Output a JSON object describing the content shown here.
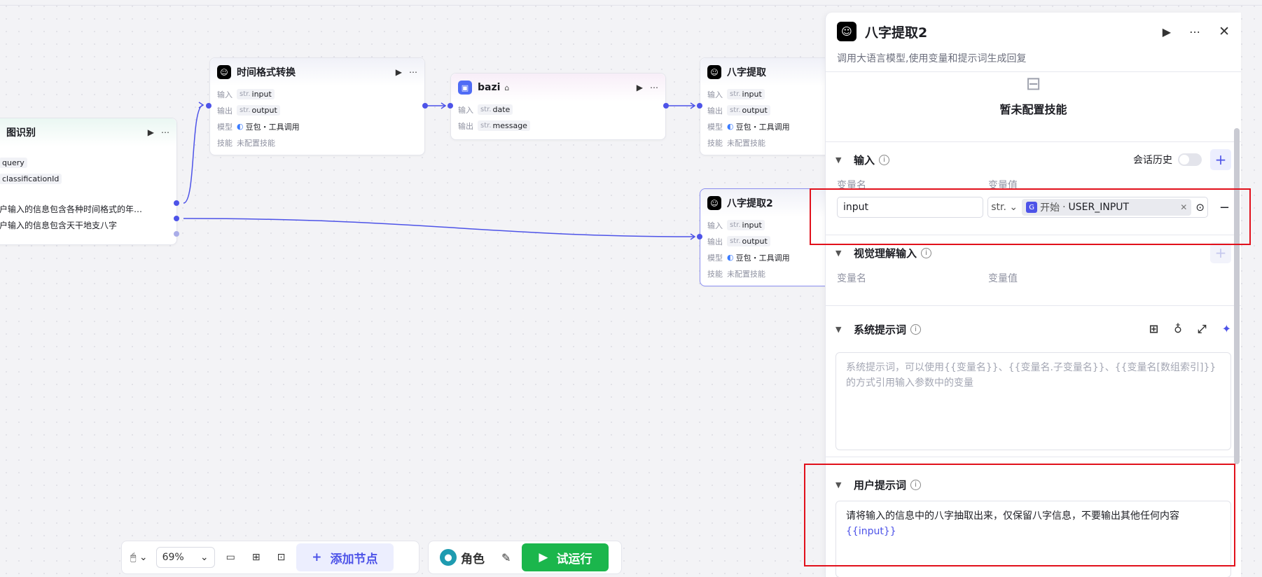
{
  "canvas": {
    "node_intent": {
      "title": "图识别",
      "inputs": [
        "query",
        "classificationId"
      ],
      "options": [
        "户输入的信息包含各种时间格式的年…",
        "户输入的信息包含天干地支八字"
      ]
    },
    "node_time": {
      "title": "时间格式转换",
      "rows": [
        {
          "label": "输入",
          "type": "str.",
          "value": "input"
        },
        {
          "label": "输出",
          "type": "str.",
          "value": "output"
        },
        {
          "label": "模型",
          "value": "豆包・工具调用"
        },
        {
          "label": "技能",
          "value": "未配置技能"
        }
      ]
    },
    "node_bazi": {
      "title": "bazi",
      "rows": [
        {
          "label": "输入",
          "type": "str.",
          "value": "date"
        },
        {
          "label": "输出",
          "type": "str.",
          "value": "message"
        }
      ]
    },
    "node_extract1": {
      "title": "八字提取",
      "rows": [
        {
          "label": "输入",
          "type": "str.",
          "value": "input"
        },
        {
          "label": "输出",
          "type": "str.",
          "value": "output"
        },
        {
          "label": "模型",
          "value": "豆包・工具调用"
        },
        {
          "label": "技能",
          "value": "未配置技能"
        }
      ]
    },
    "node_extract2": {
      "title": "八字提取2",
      "rows": [
        {
          "label": "输入",
          "type": "str.",
          "value": "input"
        },
        {
          "label": "输出",
          "type": "str.",
          "value": "output"
        },
        {
          "label": "模型",
          "value": "豆包・工具调用"
        },
        {
          "label": "技能",
          "value": "未配置技能"
        }
      ]
    }
  },
  "panel": {
    "title": "八字提取2",
    "description": "调用大语言模型,使用变量和提示词生成回复",
    "skills_empty": "暂未配置技能",
    "input_section": {
      "title": "输入",
      "history_label": "会话历史",
      "col_name": "变量名",
      "col_value": "变量值",
      "var_name": "input",
      "var_type": "str.",
      "ref_source": "开始",
      "ref_sep": "·",
      "ref_var": "USER_INPUT"
    },
    "vision_section": {
      "title": "视觉理解输入",
      "col_name": "变量名",
      "col_value": "变量值"
    },
    "system_prompt": {
      "title": "系统提示词",
      "placeholder": "系统提示词，可以使用{{变量名}}、{{变量名.子变量名}}、{{变量名[数组索引]}}的方式引用输入参数中的变量"
    },
    "user_prompt": {
      "title": "用户提示词",
      "text": "请将输入的信息中的八字抽取出来，仅保留八字信息，不要输出其他任何内容",
      "variable": "{{input}}"
    }
  },
  "toolbar": {
    "zoom": "69%",
    "add_node": "添加节点",
    "role": "角色",
    "run": "试运行"
  },
  "colors": {
    "accent": "#4d53e8",
    "run_green": "#1bb64c",
    "highlight_red": "#e1101b"
  }
}
